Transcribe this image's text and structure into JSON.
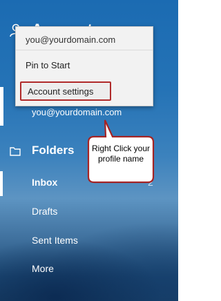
{
  "sidebar": {
    "accounts_title": "Accounts",
    "account_email": "you@yourdomain.com",
    "folders_title": "Folders",
    "folders": [
      {
        "label": "Inbox",
        "count": "2"
      },
      {
        "label": "Drafts"
      },
      {
        "label": "Sent Items"
      },
      {
        "label": "More"
      }
    ]
  },
  "context_menu": {
    "header_email": "you@yourdomain.com",
    "items": [
      {
        "label": "Pin to Start"
      },
      {
        "label": "Account settings"
      }
    ]
  },
  "callout": {
    "text": "Right Click your profile name"
  },
  "colors": {
    "accent_blue": "#1b6bb2",
    "highlight_red": "#b02a2a",
    "menu_background": "#f2f2f2"
  },
  "icons": [
    "person-icon",
    "folder-icon"
  ]
}
